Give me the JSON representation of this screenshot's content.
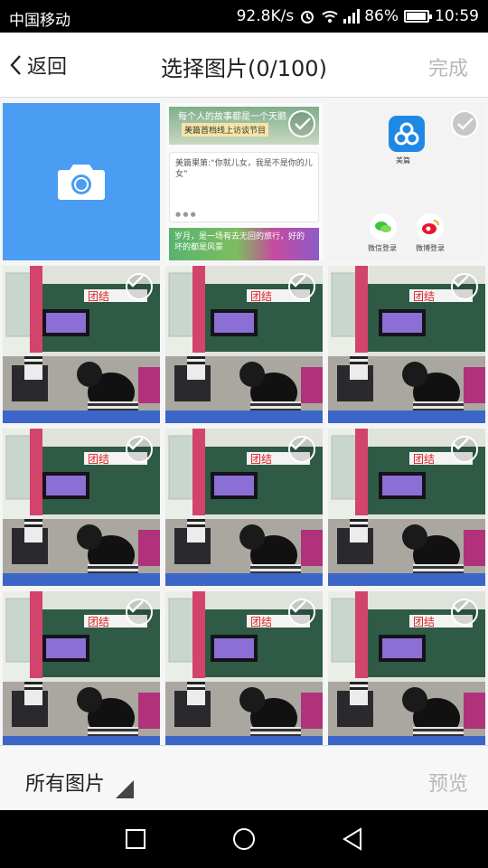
{
  "status": {
    "carrier": "中国移动",
    "speed": "92.8K/s",
    "battery": "86%",
    "time": "10:59",
    "battery_level": 0.86
  },
  "header": {
    "back_label": "返回",
    "title": "选择图片(0/100)",
    "done_label": "完成"
  },
  "grid": {
    "camera_icon": "camera-icon",
    "news_tile": {
      "top_text": "每个人的故事都是一个天鹅",
      "top_tag": "美篇首档线上访谈节目",
      "card_text": "美篇果第:“你就儿女，我是不是你的儿女”",
      "bottom_text": "岁月，是一场有去无回的旅行，好的坏的都是风景"
    },
    "app_tile": {
      "apps": [
        {
          "label": "美篇",
          "icon": "meipian-icon"
        },
        {
          "label": "微信登录",
          "icon": "wechat-icon"
        },
        {
          "label": "微博登录",
          "icon": "weibo-icon"
        }
      ]
    },
    "photo_count": 9
  },
  "bottom": {
    "album_label": "所有图片",
    "preview_label": "预览"
  },
  "colors": {
    "camera_tile": "#4a9df3",
    "header_bg": "#ffffff",
    "disabled_text": "#b8b8b8"
  }
}
